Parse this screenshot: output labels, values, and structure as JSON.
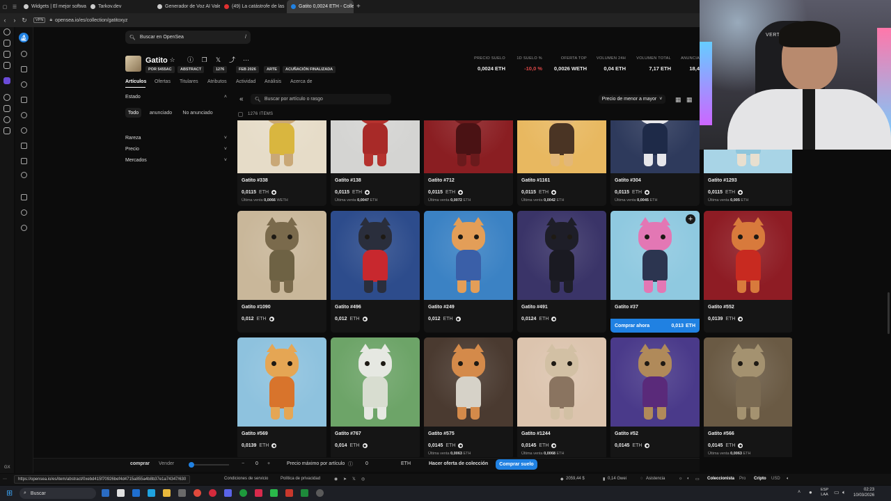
{
  "browser": {
    "tabs": [
      {
        "label": "Widgets | El mejor software",
        "color": "#cccccc"
      },
      {
        "label": "Tarkov.dev",
        "color": "#cccccc"
      },
      {
        "label": "Generador de Voz AI Vale",
        "color": "#cccccc"
      },
      {
        "label": "(49) La catástrofe de las",
        "color": "#e03030"
      },
      {
        "label": "Gatito 0,0024 ETH - Colle",
        "color": "#2081e2"
      }
    ],
    "new_tab": "+",
    "vpn": "VPN",
    "url": "opensea.io/es/collection/gatitoxyz"
  },
  "search": {
    "placeholder": "Buscar en OpenSea",
    "shortcut": "/"
  },
  "collection": {
    "name": "Gatito",
    "pills": [
      "POR 5455AC",
      "ABSTRACT",
      "1276",
      "FEB 2026",
      "ARTE",
      "ACUÑACIÓN FINALIZADA"
    ],
    "stats": [
      {
        "label": "PRECIO SUELO",
        "value": "0,0024 ETH",
        "color": "#eeeeee"
      },
      {
        "label": "1D SUELO %",
        "value": "-10,0 %",
        "color": "#e04848"
      },
      {
        "label": "OFERTA TOP",
        "value": "0,0026 WETH",
        "color": "#eeeeee"
      },
      {
        "label": "VOLUMEN 24H",
        "value": "0,04 ETH",
        "color": "#eeeeee"
      },
      {
        "label": "VOLUMEN TOTAL",
        "value": "7,17 ETH",
        "color": "#eeeeee"
      },
      {
        "label": "ANUNCIA",
        "value": "18,4",
        "color": "#eeeeee"
      }
    ]
  },
  "tabs": [
    "Artículos",
    "Ofertas",
    "Titulares",
    "Atributos",
    "Actividad",
    "Análisis",
    "Acerca de"
  ],
  "filters": {
    "estado": "Estado",
    "estado_options": [
      "Todo",
      "anunciado",
      "No anunciado"
    ],
    "sections": [
      "Rareza",
      "Precio",
      "Mercados"
    ]
  },
  "toolbar": {
    "item_search": "Buscar por artículo o rasgo",
    "sort": "Precio de menor a mayor",
    "count": "1276 ITEMS"
  },
  "cards": [
    {
      "name": "Gatito #338",
      "price": "0,0115",
      "unit": "ETH",
      "last_label": "Última venta",
      "last": "0,0066",
      "last_unit": "WETH",
      "bg": "#e6dcc8",
      "fur": "#c9a877",
      "outfit": "#d9b63f"
    },
    {
      "name": "Gatito #138",
      "price": "0,0115",
      "unit": "ETH",
      "last_label": "Última venta",
      "last": "0,0047",
      "last_unit": "ETH",
      "bg": "#d4d4d2",
      "fur": "#b5322e",
      "outfit": "#a82a28"
    },
    {
      "name": "Gatito #712",
      "price": "0,0115",
      "unit": "ETH",
      "last_label": "Última venta",
      "last": "0,0072",
      "last_unit": "ETH",
      "bg": "#8a1e22",
      "fur": "#6a1a1c",
      "outfit": "#4a1214"
    },
    {
      "name": "Gatito #1161",
      "price": "0,0115",
      "unit": "ETH",
      "last_label": "Última venta",
      "last": "0,0042",
      "last_unit": "ETH",
      "bg": "#e8b860",
      "fur": "#e3b777",
      "outfit": "#4a3424"
    },
    {
      "name": "Gatito #304",
      "price": "0,0115",
      "unit": "ETH",
      "last_label": "Última venta",
      "last": "0,0045",
      "last_unit": "ETH",
      "bg": "#2e3a5c",
      "fur": "#e6e6ea",
      "outfit": "#1e2a48"
    },
    {
      "name": "Gatito #1293",
      "price": "0,0115",
      "unit": "ETH",
      "last_label": "Última venta",
      "last": "0,005",
      "last_unit": "ETH",
      "bg": "#a8d4e6",
      "fur": "#e8dfcf",
      "outfit": "#8fc6dc"
    },
    {
      "name": "Gatito #1090",
      "price": "0,012",
      "unit": "ETH",
      "bg": "#c9b79a",
      "fur": "#7a6a4c",
      "outfit": "#6e6244"
    },
    {
      "name": "Gatito #496",
      "price": "0,012",
      "unit": "ETH",
      "bg": "#2d4c8c",
      "fur": "#2a2e3c",
      "outfit": "#c8282e"
    },
    {
      "name": "Gatito #249",
      "price": "0,012",
      "unit": "ETH",
      "bg": "#3b82c4",
      "fur": "#e39e58",
      "outfit": "#3a5fa8"
    },
    {
      "name": "Gatito #491",
      "price": "0,0124",
      "unit": "ETH",
      "bg": "#3a3468",
      "fur": "#1e1e28",
      "outfit": "#1a1a22"
    },
    {
      "name": "Gatito #37",
      "price": "0,013",
      "unit": "ETH",
      "buy_label": "Comprar ahora",
      "bg": "#8fc9e0",
      "fur": "#e377b4",
      "outfit": "#2c3550"
    },
    {
      "name": "Gatito #552",
      "price": "0,0139",
      "unit": "ETH",
      "bg": "#8e1c24",
      "fur": "#d87a3c",
      "outfit": "#c82a20"
    },
    {
      "name": "Gatito #569",
      "price": "0,0139",
      "unit": "ETH",
      "bg": "#8ec2de",
      "fur": "#e5a654",
      "outfit": "#d8742c"
    },
    {
      "name": "Gatito #767",
      "price": "0,014",
      "unit": "ETH",
      "bg": "#6da468",
      "fur": "#e6e8e2",
      "outfit": "#d8ddd0"
    },
    {
      "name": "Gatito #575",
      "price": "0,0145",
      "unit": "ETH",
      "last_label": "Última venta",
      "last": "0,0063",
      "last_unit": "ETH",
      "bg": "#4a3a30",
      "fur": "#d48a4a",
      "outfit": "#d6d2c8"
    },
    {
      "name": "Gatito #1244",
      "price": "0,0145",
      "unit": "ETH",
      "last_label": "Última venta",
      "last": "0,0068",
      "last_unit": "ETH",
      "bg": "#dcc4ae",
      "fur": "#d2c0a4",
      "outfit": "#8a7460"
    },
    {
      "name": "Gatito #52",
      "price": "0,0145",
      "unit": "ETH",
      "bg": "#4a3a8a",
      "fur": "#b08a5a",
      "outfit": "#5a2a7a"
    },
    {
      "name": "Gatito #566",
      "price": "0,0145",
      "unit": "ETH",
      "last_label": "Última venta",
      "last": "0,0063",
      "last_unit": "ETH",
      "bg": "#6a5a44",
      "fur": "#a49270",
      "outfit": "#7a6a52"
    }
  ],
  "bottom": {
    "buy": "comprar",
    "sell": "Vender",
    "qty_minus": "−",
    "qty": "0",
    "qty_plus": "+",
    "max_price_label": "Precio máximo por artículo",
    "max_price": "0",
    "max_unit": "ETH",
    "collection_offer": "Hacer oferta de colección",
    "buy_floor": "Comprar suelo"
  },
  "footer": {
    "status_url": "https://opensea.io/es/item/abstract/0xebd415f70926bef4d4715a855a4b8b37e1a74347/630",
    "terms": "Condiciones de servicio",
    "privacy": "Política de privacidad",
    "eth_price": "2059,44 $",
    "gas": "0,14 Gwei",
    "support": "Asistencia",
    "mode": "Coleccionista",
    "pro": "Pro",
    "crypto": "Cripto",
    "currency": "USD"
  },
  "taskbar": {
    "search": "Buscar",
    "lang": "ESP",
    "lang2": "LAA",
    "time": "02:23",
    "date": "10/03/2026"
  },
  "webcam": {
    "chair_brand": "VERTAGEAR"
  },
  "colors": {
    "accent": "#2081e2",
    "negative": "#e04848",
    "bg": "#0c0c0c"
  }
}
